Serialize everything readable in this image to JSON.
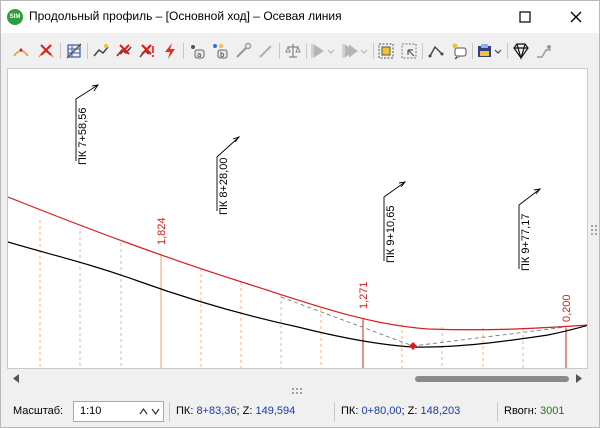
{
  "window": {
    "title": "Продольный профиль – [Основной ход] – Осевая линия",
    "app_icon_text": "SIM"
  },
  "toolbar": {
    "buttons": [
      "add-vertex-icon",
      "delete-vertex-icon",
      "table-edit-icon",
      "add-line-icon",
      "delete-line-icon",
      "delete-all-icon",
      "flash-icon",
      "point-a-icon",
      "point-b-icon",
      "brush-icon",
      "pencil-icon",
      "balance-icon",
      "play-icon",
      "play-next-icon",
      "select-icon",
      "frame-icon",
      "tangent-icon",
      "callout-icon",
      "printer-icon",
      "diamond-icon",
      "profile-tool-icon"
    ]
  },
  "profile": {
    "stations": [
      {
        "label": "ПК 7+58,56"
      },
      {
        "label": "ПК 8+28,00"
      },
      {
        "label": "ПК 9+10,65"
      },
      {
        "label": "ПК 9+77,17"
      }
    ],
    "marks": [
      {
        "label": "1,824"
      },
      {
        "label": "1,271"
      },
      {
        "label": "0,200"
      }
    ],
    "colors": {
      "design_line": "#d91c1c",
      "ground_line": "#000000",
      "station_leader": "#f0a060",
      "dashed_line": "#7a7a7a"
    }
  },
  "status": {
    "scale_label": "Масштаб:",
    "scale_value": "1:10",
    "cursor_label_pk": "ПК:",
    "cursor_pk": "8+83,36",
    "cursor_label_z": "; Z:",
    "cursor_z": "149,594",
    "point_label_pk": "ПК:",
    "point_pk": "0+80,00",
    "point_label_z": "; Z:",
    "point_z": "148,203",
    "radius_label": "Rвогн:",
    "radius_value": "3001"
  }
}
